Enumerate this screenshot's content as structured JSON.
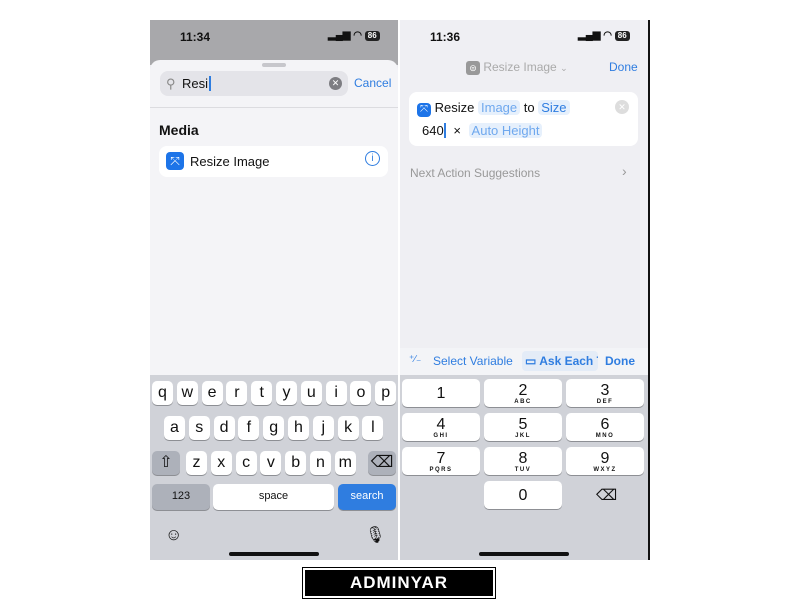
{
  "left": {
    "time": "11:34",
    "battery": "86",
    "search": {
      "value": "Resi",
      "cancel": "Cancel"
    },
    "section": "Media",
    "result": {
      "label": "Resize Image",
      "icon": "resize-icon",
      "info_icon": "info-icon"
    },
    "keyboard": {
      "row1": [
        "q",
        "w",
        "e",
        "r",
        "t",
        "y",
        "u",
        "i",
        "o",
        "p"
      ],
      "row2": [
        "a",
        "s",
        "d",
        "f",
        "g",
        "h",
        "j",
        "k",
        "l"
      ],
      "row3": [
        "z",
        "x",
        "c",
        "v",
        "b",
        "n",
        "m"
      ],
      "numbers": "123",
      "space": "space",
      "search": "search"
    }
  },
  "right": {
    "time": "11:36",
    "battery": "86",
    "header": {
      "title": "Resize Image",
      "done": "Done"
    },
    "action": {
      "verb": "Resize",
      "image": "Image",
      "to": "to",
      "size": "Size",
      "width": "640",
      "times": "×",
      "height": "Auto Height"
    },
    "suggestions": "Next Action Suggestions",
    "toolbar": {
      "percent": "⁺∕₋",
      "select_variable": "Select Variable",
      "ask_each_time": "Ask Each T",
      "done": "Done"
    },
    "numpad": [
      {
        "d": "1",
        "l": ""
      },
      {
        "d": "2",
        "l": "ABC"
      },
      {
        "d": "3",
        "l": "DEF"
      },
      {
        "d": "4",
        "l": "GHI"
      },
      {
        "d": "5",
        "l": "JKL"
      },
      {
        "d": "6",
        "l": "MNO"
      },
      {
        "d": "7",
        "l": "PQRS"
      },
      {
        "d": "8",
        "l": "TUV"
      },
      {
        "d": "9",
        "l": "WXYZ"
      },
      {
        "d": "0",
        "l": ""
      }
    ]
  },
  "watermark": "ADMINYAR",
  "colors": {
    "accent": "#2f7de0",
    "keyboard": "#d0d2d8"
  }
}
